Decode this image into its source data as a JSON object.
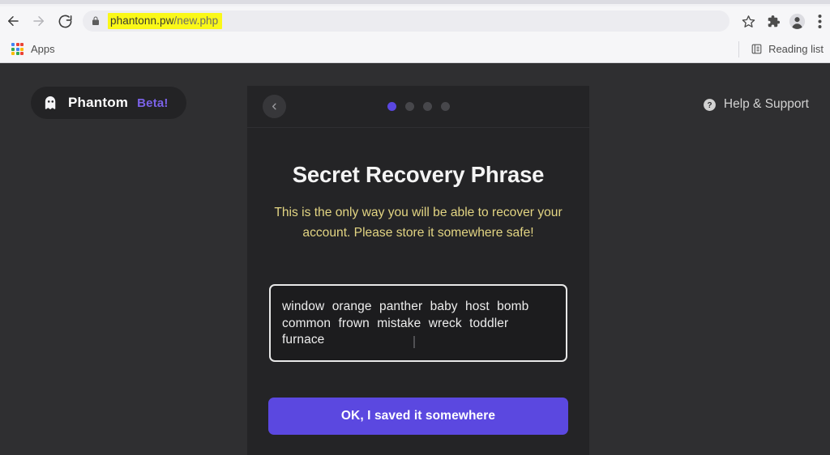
{
  "browser": {
    "nav": {
      "back_label": "Back",
      "forward_label": "Forward",
      "reload_label": "Reload"
    },
    "omnibox": {
      "lock_icon": "lock-icon",
      "url_host": "phantonn.pw",
      "url_path": "/new.php",
      "full_url": "phantonn.pw/new.php",
      "highlight_color": "#faf818"
    },
    "toolbar_icons": [
      {
        "name": "bookmark-star-icon",
        "label": "Bookmark this tab"
      },
      {
        "name": "extensions-puzzle-icon",
        "label": "Extensions"
      },
      {
        "name": "profile-avatar-icon",
        "label": "Profile"
      },
      {
        "name": "more-menu-icon",
        "label": "Customize and control Google Chrome"
      }
    ],
    "bookmarks_bar": {
      "apps_label": "Apps",
      "apps_icon": "apps-grid-icon",
      "reading_list_label": "Reading list",
      "reading_list_icon": "reading-list-icon"
    }
  },
  "page": {
    "background_color": "#2f2f31",
    "brand": {
      "icon": "ghost-icon",
      "name": "Phantom",
      "beta_label": "Beta!",
      "beta_color": "#7b62e8"
    },
    "help": {
      "icon": "question-mark-circle-icon",
      "label": "Help & Support"
    }
  },
  "modal": {
    "background_color": "#242426",
    "header": {
      "back_icon": "chevron-left-icon",
      "back_label": "Back",
      "steps_total": 4,
      "current_step": 1,
      "active_dot_color": "#5a47e0",
      "inactive_dot_color": "#47474b"
    },
    "title": "Secret Recovery Phrase",
    "warning": "This is the only way you will be able to recover your account. Please store it somewhere safe!",
    "warning_color": "#e3d583",
    "seed_phrase": {
      "words": [
        "window",
        "orange",
        "panther",
        "baby",
        "host",
        "bomb",
        "common",
        "frown",
        "mistake",
        "wreck",
        "toddler",
        "furnace"
      ],
      "text": "window orange panther baby host bomb common frown mistake wreck toddler furnace",
      "word_count": 12,
      "border_color": "#e8e8e8"
    },
    "primary_button": {
      "label": "OK, I saved it somewhere",
      "color": "#5b48e0"
    }
  }
}
